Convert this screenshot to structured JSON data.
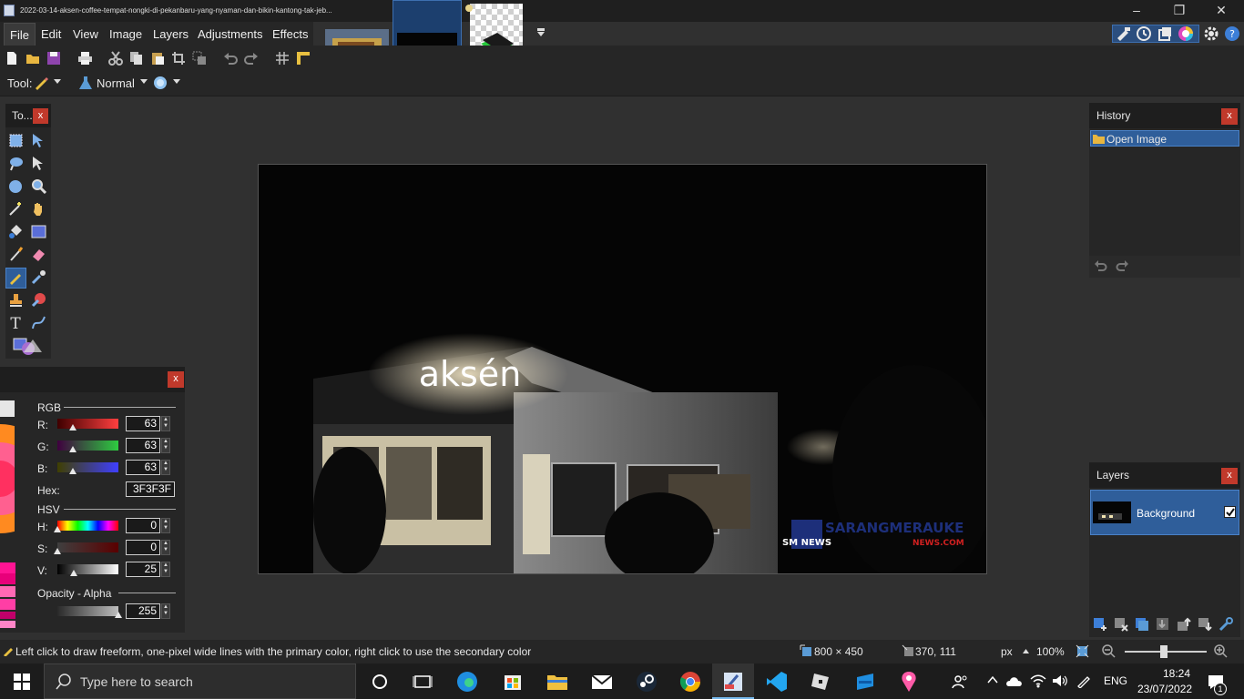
{
  "window": {
    "title": "2022-03-14-aksen-coffee-tempat-nongki-di-pekanbaru-yang-nyaman-dan-bikin-kantong-tak-jeb..."
  },
  "menu": [
    "File",
    "Edit",
    "View",
    "Image",
    "Layers",
    "Adjustments",
    "Effects"
  ],
  "toolbar": {
    "tool_label": "Tool:",
    "blend_mode": "Normal"
  },
  "tools_panel": {
    "title": "To..."
  },
  "colors_panel": {
    "rgb_heading": "RGB",
    "r_label": "R:",
    "r_value": "63",
    "g_label": "G:",
    "g_value": "63",
    "b_label": "B:",
    "b_value": "63",
    "hex_label": "Hex:",
    "hex_value": "3F3F3F",
    "hsv_heading": "HSV",
    "h_label": "H:",
    "h_value": "0",
    "s_label": "S:",
    "s_value": "0",
    "v_label": "V:",
    "v_value": "25",
    "opacity_heading": "Opacity - Alpha",
    "alpha_value": "255",
    "primary_color": "#3f3f3f"
  },
  "history_panel": {
    "title": "History",
    "items": [
      "Open Image"
    ]
  },
  "layers_panel": {
    "title": "Layers",
    "layers": [
      {
        "name": "Background",
        "visible": true
      }
    ]
  },
  "canvas": {
    "sign_text": "aksén",
    "watermark_brand": "SARANGMERAUKE",
    "watermark_sub": "NEWS.COM",
    "watermark_logo": "SM NEWS"
  },
  "status": {
    "hint": "Left click to draw freeform, one-pixel wide lines with the primary color, right click to use the secondary color",
    "image_size": "800 × 450",
    "cursor_pos": "370, 111",
    "unit": "px",
    "zoom": "100%"
  },
  "taskbar": {
    "search_placeholder": "Type here to search",
    "language": "ENG",
    "time": "18:24",
    "date": "23/07/2022",
    "notifications": "1"
  },
  "colors": {
    "accent": "#2a5d9f",
    "panel_bg": "#262626",
    "workspace_bg": "#303030",
    "close_red": "#c0392b"
  }
}
